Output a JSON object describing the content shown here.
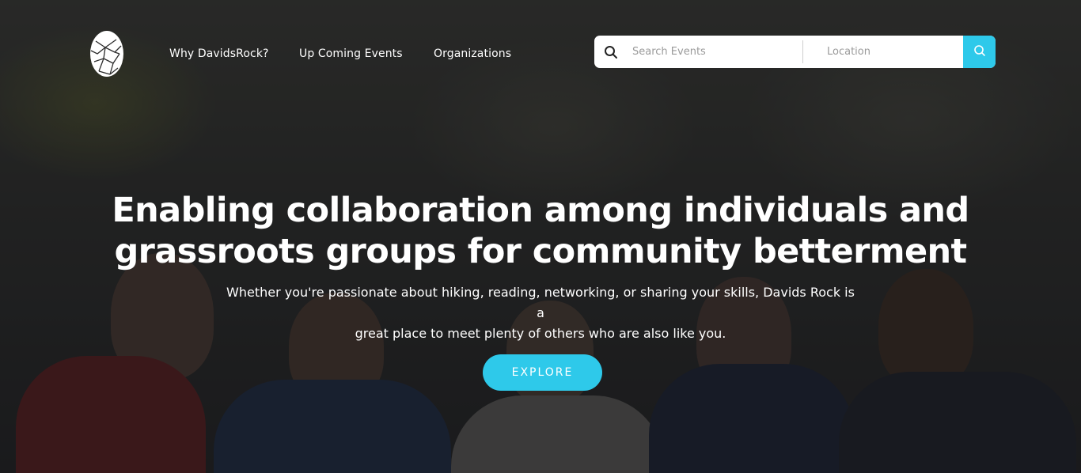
{
  "brand": {
    "logo_icon": "rock-logo-icon"
  },
  "nav": {
    "links": [
      {
        "label": "Why DavidsRock?"
      },
      {
        "label": "Up Coming Events"
      },
      {
        "label": "Organizations"
      }
    ]
  },
  "search": {
    "events_placeholder": "Search Events",
    "location_placeholder": "Location",
    "events_value": "",
    "location_value": "",
    "accent_color": "#2ec9ea"
  },
  "hero": {
    "headline_line1": "Enabling collaboration among individuals and",
    "headline_line2": "grassroots groups for community betterment",
    "sub_line1": "Whether you're passionate about hiking, reading, networking, or sharing your skills, Davids Rock is a",
    "sub_line2": "great place to meet plenty of others who are also like you.",
    "cta_label": "EXPLORE"
  }
}
